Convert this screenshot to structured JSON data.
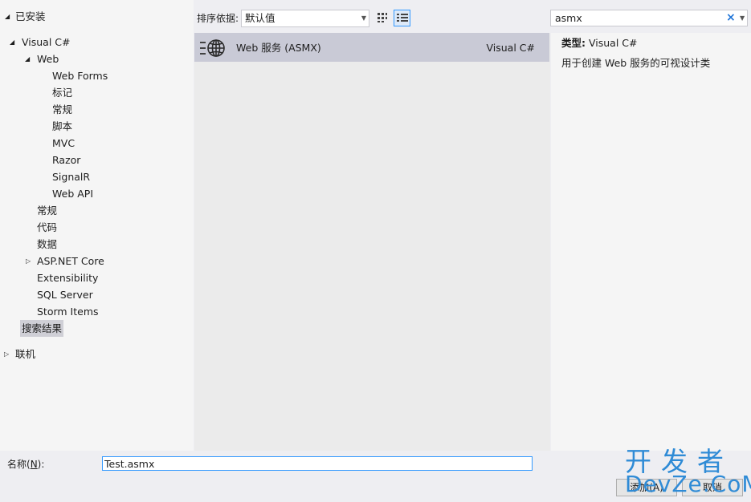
{
  "tree": {
    "installed": "已安装",
    "visual_csharp": "Visual C#",
    "web": "Web",
    "web_children": [
      "Web Forms",
      "标记",
      "常规",
      "脚本",
      "MVC",
      "Razor",
      "SignalR",
      "Web API"
    ],
    "csharp_children": [
      "常规",
      "代码",
      "数据",
      "ASP.NET Core",
      "Extensibility",
      "SQL Server",
      "Storm Items"
    ],
    "search_results": "搜索结果",
    "online": "联机"
  },
  "toolbar": {
    "sort_label": "排序依据:",
    "sort_value": "默认值"
  },
  "search": {
    "value": "asmx"
  },
  "templates": [
    {
      "name": "Web 服务 (ASMX)",
      "language": "Visual C#",
      "icon": "web-service-globe-icon"
    }
  ],
  "details": {
    "type_key": "类型:",
    "type_value": "Visual C#",
    "description": "用于创建 Web 服务的可视设计类"
  },
  "bottom": {
    "name_label_prefix": "名称(",
    "name_label_key": "N",
    "name_label_suffix": "):",
    "name_value": "Test.asmx",
    "add_label": "添加(A)",
    "cancel_label": "取消"
  },
  "watermark": {
    "cn": "开发者",
    "en": "DevZe.CoM"
  },
  "colors": {
    "accent": "#3399ff",
    "selected_item": "#c9cad6",
    "watermark": "#2f8bd6"
  }
}
